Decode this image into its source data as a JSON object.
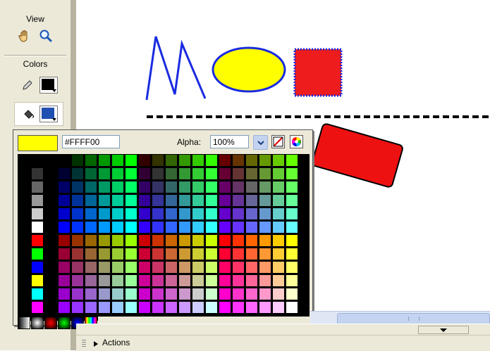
{
  "toolbox": {
    "view_label": "View",
    "colors_label": "Colors",
    "stroke_color": "#000000",
    "fill_color": "#1f4fb0"
  },
  "color_popup": {
    "hex_value": "#FFFF00",
    "selected_color": "#FFFF00",
    "alpha_label": "Alpha:",
    "alpha_value": "100%"
  },
  "panels": {
    "actions_label": "Actions"
  }
}
